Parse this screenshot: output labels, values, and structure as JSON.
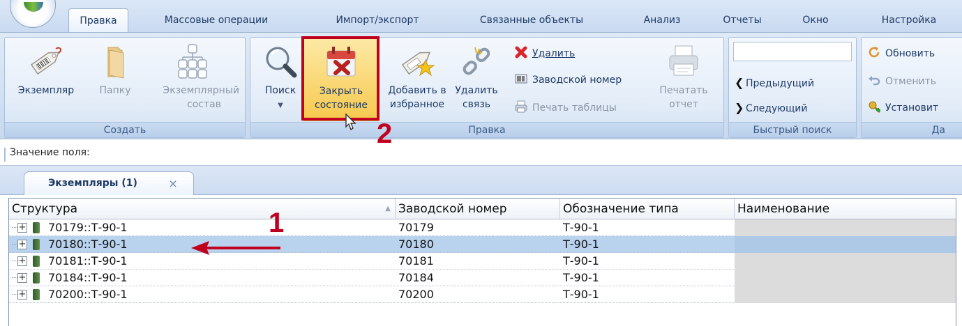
{
  "ribbon_tabs": [
    {
      "label": "Правка",
      "active": true
    },
    {
      "label": "Массовые операции"
    },
    {
      "label": "Импорт/экспорт"
    },
    {
      "label": "Связанные объекты"
    },
    {
      "label": "Анализ"
    },
    {
      "label": "Отчеты"
    },
    {
      "label": "Окно"
    },
    {
      "label": "Настройка"
    }
  ],
  "groups": {
    "create": {
      "label": "Создать",
      "buttons": [
        {
          "label": "Экземпляр",
          "icon": "tag-icon"
        },
        {
          "label": "Папку",
          "icon": "folder-icon",
          "disabled": true
        },
        {
          "label1": "Экземплярный",
          "label2": "состав",
          "icon": "structure-icon",
          "disabled": true
        }
      ]
    },
    "edit": {
      "label": "Правка",
      "search": {
        "label": "Поиск",
        "icon": "magnifier-icon"
      },
      "close_state": {
        "label1": "Закрыть",
        "label2": "состояние",
        "icon": "calendar-x-icon"
      },
      "add_fav": {
        "label1": "Добавить в",
        "label2": "избранное",
        "icon": "tag-star-icon"
      },
      "unlink": {
        "label1": "Удалить",
        "label2": "связь",
        "icon": "broken-link-icon"
      },
      "delete": {
        "label": "Удалить",
        "icon": "red-x-icon"
      },
      "serial": {
        "label": "Заводской номер",
        "icon": "barcode-icon"
      },
      "print_table": {
        "label": "Печать таблицы",
        "icon": "printer-small-icon",
        "disabled": true
      },
      "print_report": {
        "label1": "Печатать",
        "label2": "отчет",
        "icon": "printer-icon",
        "disabled": true
      }
    },
    "quick_search": {
      "label": "Быстрый поиск",
      "input_value": "",
      "prev": "Предыдущий",
      "next": "Следующий"
    },
    "data": {
      "label": "Да",
      "refresh": "Обновить",
      "cancel": "Отменить",
      "install": "Установит"
    }
  },
  "field_value_label": "Значение поля:",
  "document_tab": {
    "label": "Экземпляры (1)"
  },
  "grid": {
    "columns": [
      "Структура",
      "Заводской номер",
      "Обозначение типа",
      "Наименование"
    ],
    "rows": [
      {
        "structure": "70179::Т-90-1",
        "serial": "70179",
        "type": "Т-90-1",
        "name": ""
      },
      {
        "structure": "70180::Т-90-1",
        "serial": "70180",
        "type": "Т-90-1",
        "name": "",
        "selected": true
      },
      {
        "structure": "70181::Т-90-1",
        "serial": "70181",
        "type": "Т-90-1",
        "name": ""
      },
      {
        "structure": "70184::Т-90-1",
        "serial": "70184",
        "type": "Т-90-1",
        "name": ""
      },
      {
        "structure": "70200::Т-90-1",
        "serial": "70200",
        "type": "Т-90-1",
        "name": ""
      }
    ]
  },
  "annotations": {
    "step1": "1",
    "step2": "2"
  },
  "colors": {
    "annotation": "#c0001f",
    "selected_row": "#b9d3ef",
    "ribbon": "#dfeaf7"
  }
}
